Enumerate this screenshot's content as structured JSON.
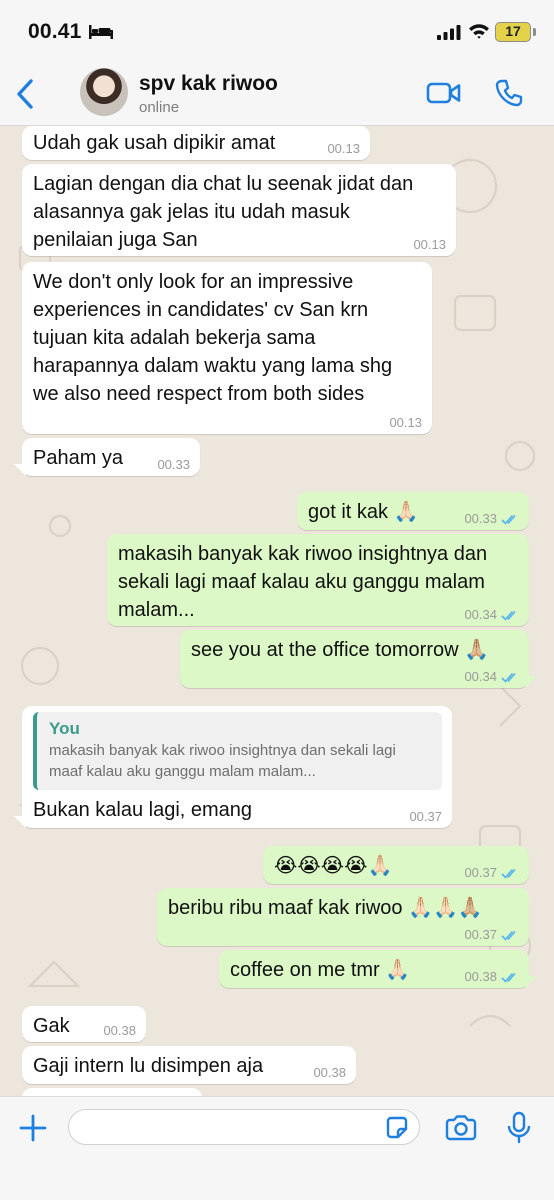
{
  "status_bar": {
    "time": "00.41",
    "battery_level": "17",
    "icons": [
      "sleep-bed-icon",
      "cellular-signal-icon",
      "wifi-icon",
      "battery-icon"
    ]
  },
  "header": {
    "contact_name": "spv kak riwoo",
    "contact_status": "online",
    "icons": [
      "back-chevron-icon",
      "avatar",
      "video-call-icon",
      "phone-call-icon"
    ]
  },
  "colors": {
    "accent": "#1f7fe0",
    "incoming_bubble": "#ffffff",
    "outgoing_bubble": "#dcf8c6",
    "chat_background": "#ede6dc",
    "read_ticks": "#4fb5ec",
    "quote_bar": "#3a9b8d"
  },
  "messages": [
    {
      "direction": "in",
      "text": "Udah gak usah dipikir amat",
      "time": "00.13"
    },
    {
      "direction": "in",
      "text": "Lagian dengan dia chat lu seenak jidat dan\nalasannya gak jelas itu udah masuk\npenilaian juga San",
      "time": "00.13"
    },
    {
      "direction": "in",
      "text": "We don't only look for an impressive\nexperiences in candidates' cv San krn\ntujuan kita adalah bekerja sama\nharapannya dalam waktu yang lama shg\nwe also need respect from both sides",
      "time": "00.13"
    },
    {
      "direction": "in",
      "text": "Paham ya",
      "time": "00.33"
    },
    {
      "direction": "out",
      "text": "got it kak 🙏🏻",
      "time": "00.33",
      "read": true
    },
    {
      "direction": "out",
      "text": "makasih banyak kak riwoo insightnya dan\nsekali lagi maaf kalau aku ganggu malam\nmalam...",
      "time": "00.34",
      "read": true
    },
    {
      "direction": "out",
      "text": "see you at the office tomorrow 🙏🏼",
      "time": "00.34",
      "read": true
    },
    {
      "direction": "in",
      "text": "Bukan kalau lagi, emang",
      "time": "00.37",
      "quote": {
        "author": "You",
        "text": "makasih banyak kak riwoo insightnya dan sekali lagi\nmaaf kalau aku ganggu malam malam..."
      }
    },
    {
      "direction": "out",
      "text": "😭😭😭😭🙏🏻",
      "time": "00.37",
      "read": true
    },
    {
      "direction": "out",
      "text": "beribu ribu maaf kak riwoo 🙏🏻🙏🏻🙏🏼",
      "time": "00.37",
      "read": true
    },
    {
      "direction": "out",
      "text": "coffee on me tmr 🙏🏻",
      "time": "00.38",
      "read": true
    },
    {
      "direction": "in",
      "text": "Gak",
      "time": "00.38"
    },
    {
      "direction": "in",
      "text": "Gaji intern lu disimpen aja",
      "time": "00.38"
    }
  ],
  "input_bar": {
    "placeholder": "",
    "icons": [
      "plus-icon",
      "sticker-icon",
      "camera-icon",
      "microphone-icon"
    ]
  }
}
